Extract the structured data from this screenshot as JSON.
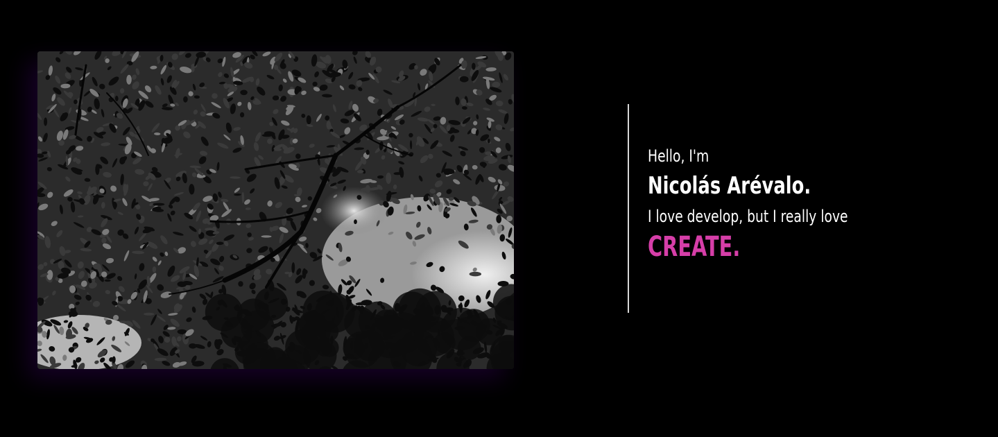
{
  "hero": {
    "image": {
      "alt": "Black and white photo looking up through tree canopy",
      "tones": {
        "sky": "#d9d9d9",
        "leaf_dark": "#0d0d0d",
        "leaf_mid": "#3a3a3a",
        "leaf_light": "#7a7a7a",
        "branch": "#050505"
      }
    },
    "intro": {
      "greeting": "Hello, I'm",
      "name": "Nicolás Arévalo.",
      "tagline": "I love develop, but I really love",
      "highlight": "CREATE."
    },
    "colors": {
      "background": "#000000",
      "text": "#ffffff",
      "accent": "#d63ea8",
      "divider": "#d8d8d8"
    }
  }
}
